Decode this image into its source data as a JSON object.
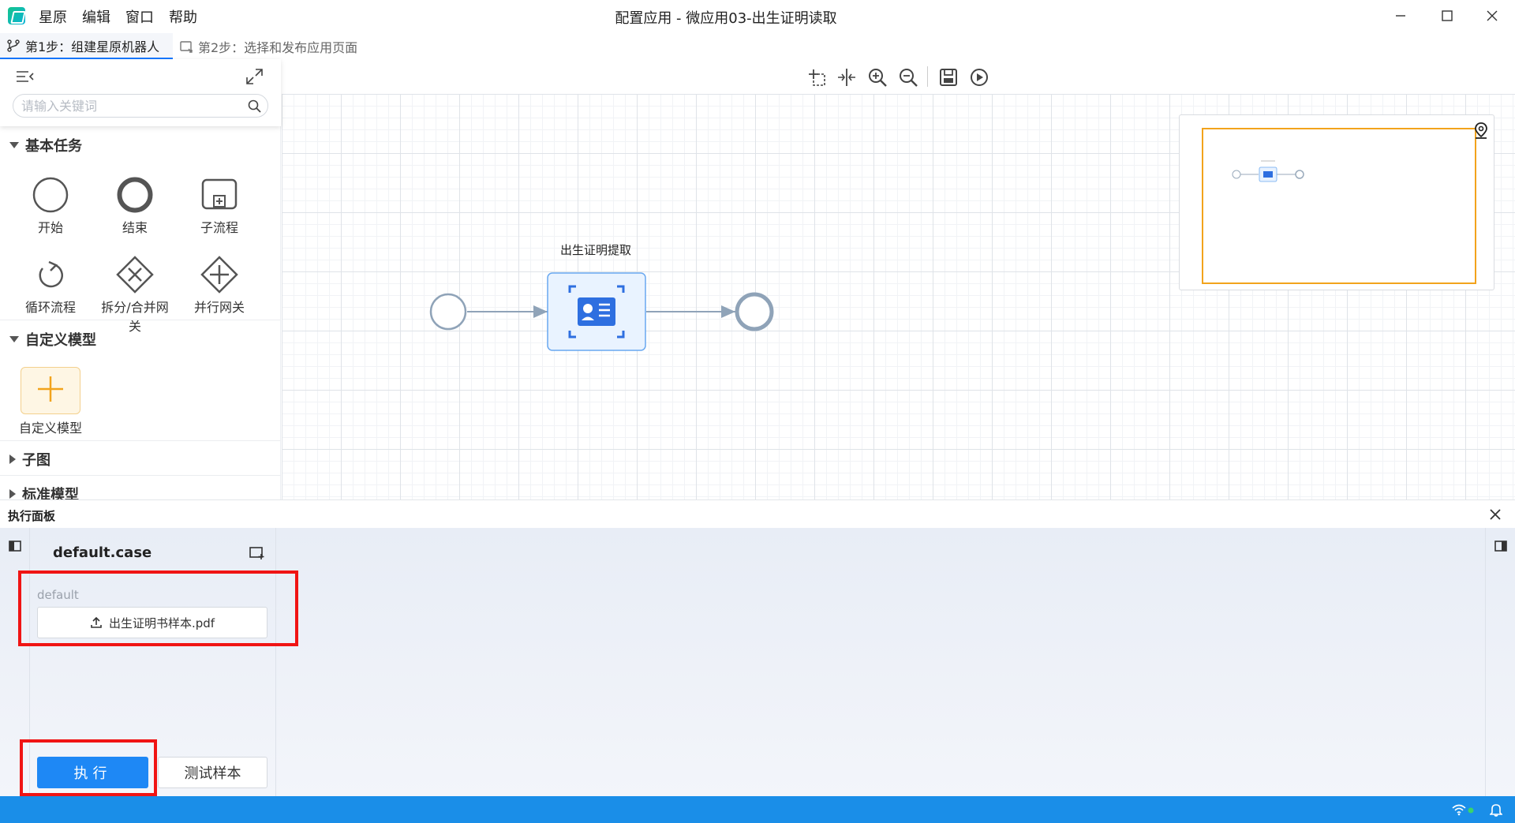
{
  "menu": [
    "星原",
    "编辑",
    "窗口",
    "帮助"
  ],
  "window_title": "配置应用 - 微应用03-出生证明读取",
  "tabs": [
    {
      "label": "第1步：组建星原机器人",
      "icon": "branch-icon"
    },
    {
      "label": "第2步：选择和发布应用页面",
      "icon": "publish-icon"
    }
  ],
  "search": {
    "placeholder": "请输入关键词"
  },
  "sections": {
    "basic": "基本任务",
    "custom": "自定义模型",
    "subgraph": "子图",
    "standard": "标准模型"
  },
  "basic_tools": [
    "开始",
    "结束",
    "子流程",
    "循环流程",
    "拆分/合并网关",
    "并行网关"
  ],
  "custom_tools": [
    "自定义模型"
  ],
  "canvas": {
    "node_label": "出生证明提取",
    "toolbar_icons": [
      "select-area-icon",
      "fit-icon",
      "zoom-in-icon",
      "zoom-out-icon",
      "save-icon",
      "run-icon"
    ]
  },
  "exec_panel": {
    "title": "执行面板",
    "case_name": "default.case",
    "case_group": "default",
    "file_name": "出生证明书样本.pdf",
    "execute_label": "执行",
    "test_label": "测试样本"
  },
  "colors": {
    "accent": "#1e88f5",
    "status_bar": "#1a8ee8",
    "highlight": "#f01414",
    "minimap_view": "#f2a31c"
  }
}
